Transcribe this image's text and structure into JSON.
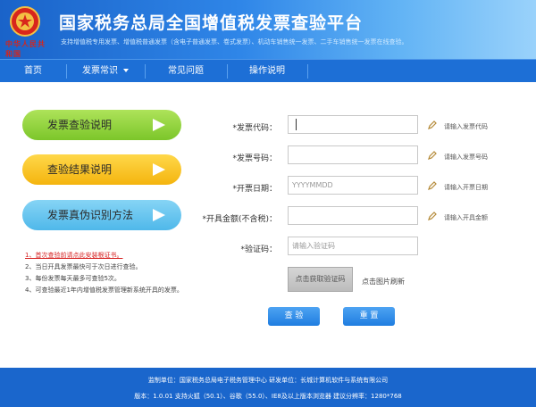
{
  "header": {
    "emblem_text": "中华人民共和国",
    "title": "国家税务总局全国增值税发票查验平台",
    "subtitle": "支持增值税专用发票、增值税普通发票（含电子普通发票、卷式发票）、机动车销售统一发票、二手车销售统一发票在线查验。"
  },
  "nav": {
    "items": [
      "首页",
      "发票常识",
      "常见问题",
      "操作说明"
    ]
  },
  "side": {
    "pills": [
      "发票查验说明",
      "查验结果说明",
      "发票真伪识别方法"
    ],
    "notes": [
      "1、首次查验前请点此安装根证书。",
      "2、当日开具发票最快可于次日进行查验。",
      "3、每份发票每天最多可查验5次。",
      "4、可查验最近1年内增值税发票管理新系统开具的发票。"
    ]
  },
  "form": {
    "fields": [
      {
        "label": "*发票代码：",
        "placeholder": "",
        "hint": "请输入发票代码"
      },
      {
        "label": "*发票号码：",
        "placeholder": "",
        "hint": "请输入发票号码"
      },
      {
        "label": "*开票日期：",
        "placeholder": "YYYYMMDD",
        "hint": "请输入开票日期"
      },
      {
        "label": "*开具金额(不含税)：",
        "placeholder": "",
        "hint": "请输入开具金额"
      },
      {
        "label": "*验证码：",
        "placeholder": "请输入验证码",
        "hint": ""
      }
    ],
    "captcha_text": "点击获取验证码",
    "refresh_text": "点击图片刷新",
    "submit_label": "查 验",
    "reset_label": "重 置"
  },
  "footer": {
    "line1": "监制单位：国家税务总局电子税务管理中心      研发单位：长城计算机软件与系统有限公司",
    "line2": "版本：1.0.01    支持火狐（50.1）、谷歌（55.0）、IE8及以上版本浏览器    建议分辨率：1280*768"
  },
  "colors": {
    "header_blue": "#1d6fd6",
    "pill_green": "#7cc62a",
    "pill_yellow": "#f4b40e",
    "pill_blue": "#4fb8ea",
    "warning_red": "#d62020"
  }
}
